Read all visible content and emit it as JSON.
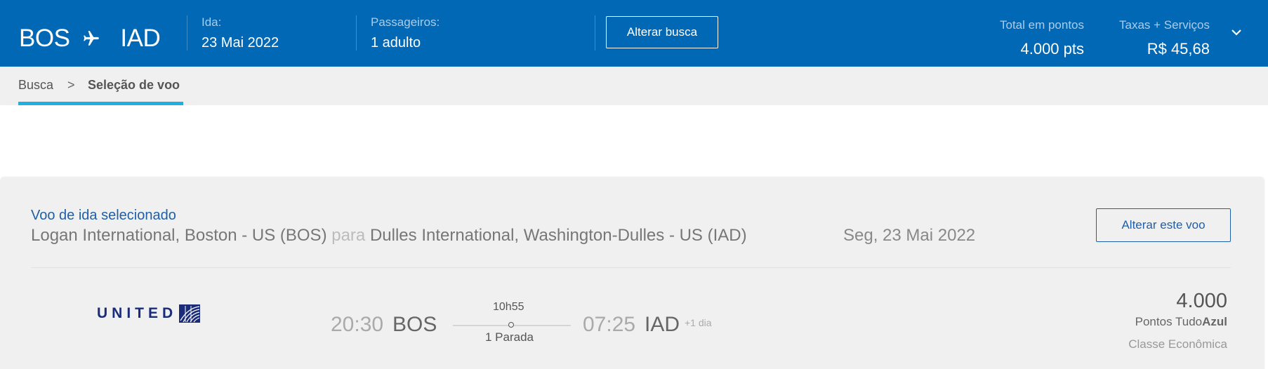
{
  "header": {
    "origin": "BOS",
    "destination": "IAD",
    "ida_label": "Ida:",
    "ida_value": "23 Mai 2022",
    "passengers_label": "Passageiros:",
    "passengers_value": "1 adulto",
    "change_search_button": "Alterar busca",
    "total_points_label": "Total em pontos",
    "total_points_value": "4.000 pts",
    "taxes_label": "Taxas + Serviços",
    "taxes_value": "R$ 45,68"
  },
  "breadcrumb": {
    "items": [
      "Busca",
      "Seleção de voo"
    ],
    "separator": ">"
  },
  "selected_flight": {
    "title": "Voo de ida selecionado",
    "origin_name": "Logan International, Boston - US (BOS)",
    "connector": "para",
    "destination_name": "Dulles International, Washington-Dulles - US (IAD)",
    "date": "Seg, 23 Mai 2022",
    "change_flight_button": "Alterar este voo"
  },
  "flight": {
    "airline": "UNITED",
    "departure_time": "20:30",
    "departure_code": "BOS",
    "duration": "10h55",
    "stops": "1 Parada",
    "arrival_time": "07:25",
    "arrival_code": "IAD",
    "day_offset": "+1 dia",
    "price_points": "4.000",
    "price_unit_prefix": "Pontos Tudo",
    "price_unit_brand": "Azul",
    "cabin": "Classe Econômica"
  },
  "colors": {
    "header_bg": "#0068b5",
    "accent_underline": "#1fb0e0",
    "link_blue": "#1f5fa8",
    "united_navy": "#1a2b7a"
  },
  "icons": [
    "airplane-icon",
    "chevron-down-icon",
    "united-globe-icon"
  ]
}
